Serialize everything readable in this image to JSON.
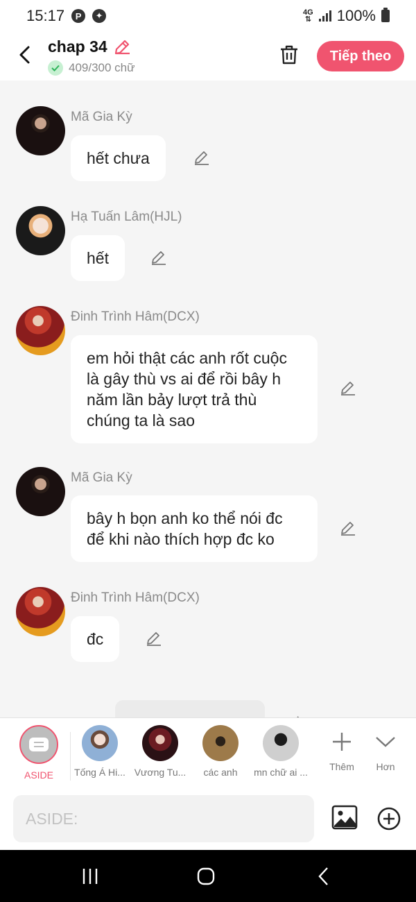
{
  "status_bar": {
    "time": "15:17",
    "network": "4G",
    "battery": "100%",
    "icons": [
      "pinterest-icon",
      "app-icon"
    ]
  },
  "header": {
    "title": "chap 34",
    "word_count": "409/300 chữ",
    "next_label": "Tiếp theo",
    "accent_color": "#f0546f"
  },
  "messages": [
    {
      "sender": "Mã Gia Kỳ",
      "text": "hết chưa"
    },
    {
      "sender": "Hạ Tuấn Lâm(HJL)",
      "text": "hết"
    },
    {
      "sender": "Đinh Trình Hâm(DCX)",
      "text": "em hỏi thật các anh rốt cuộc là gây thù vs ai để rồi bây h năm lần bảy lượt trả thù chúng ta là sao"
    },
    {
      "sender": "Mã Gia Kỳ",
      "text": "bây h bọn anh ko thể nói đc để khi nào thích hợp đc ko"
    },
    {
      "sender": "Đinh Trình Hâm(DCX)",
      "text": "đc"
    }
  ],
  "characters": [
    {
      "label": "ASIDE",
      "active": true
    },
    {
      "label": "Tống Á Hi..."
    },
    {
      "label": "Vương Tu..."
    },
    {
      "label": "các anh"
    },
    {
      "label": "mn chữ ai ..."
    }
  ],
  "tools": {
    "more_label": "Thêm",
    "collapse_label": "Hơn"
  },
  "input": {
    "placeholder": "ASIDE:"
  }
}
